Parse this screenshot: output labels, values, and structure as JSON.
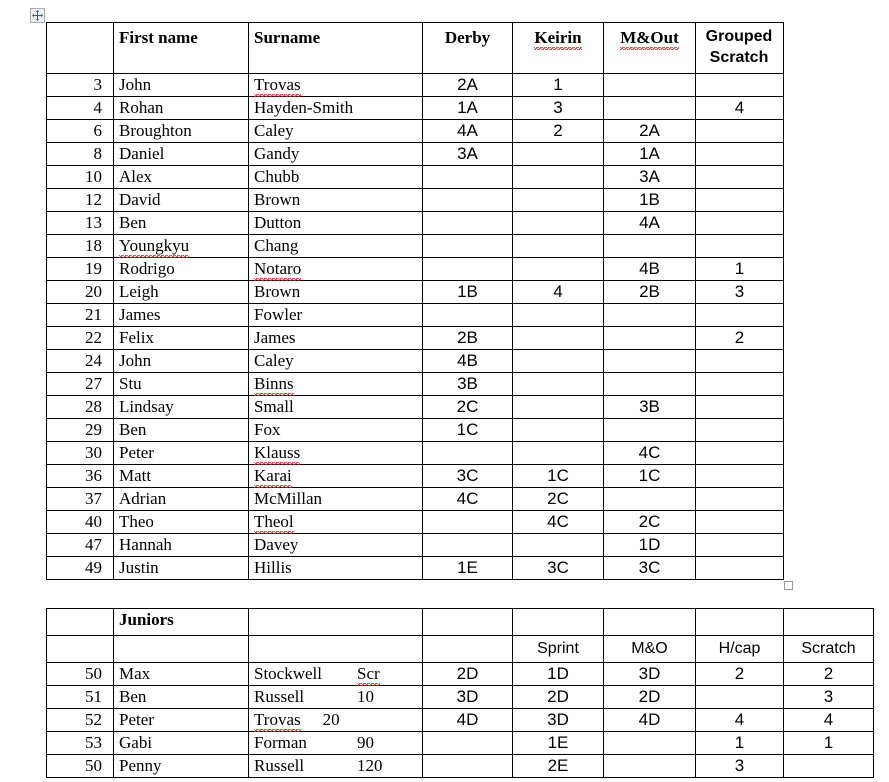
{
  "document": {
    "table_move_handle_icon": "move-cross-icon",
    "resize_handle_icon": "table-resize-handle"
  },
  "main_table": {
    "headers": {
      "number": "",
      "first_name": "First name",
      "surname": "Surname",
      "derby": "Derby",
      "keirin": "Keirin",
      "madison_out": "M&Out",
      "grouped_scratch": "Grouped Scratch"
    },
    "rows": [
      {
        "num": "3",
        "first": "John",
        "last": "Trovas",
        "last_misspelled": true,
        "first_misspelled": false,
        "derby": "2A",
        "keirin": "1",
        "mout": "",
        "gs": ""
      },
      {
        "num": "4",
        "first": "Rohan",
        "last": "Hayden-Smith",
        "last_misspelled": false,
        "first_misspelled": false,
        "derby": "1A",
        "keirin": "3",
        "mout": "",
        "gs": "4"
      },
      {
        "num": "6",
        "first": "Broughton",
        "last": "Caley",
        "last_misspelled": false,
        "first_misspelled": false,
        "derby": "4A",
        "keirin": "2",
        "mout": "2A",
        "gs": ""
      },
      {
        "num": "8",
        "first": "Daniel",
        "last": "Gandy",
        "last_misspelled": false,
        "first_misspelled": false,
        "derby": "3A",
        "keirin": "",
        "mout": "1A",
        "gs": ""
      },
      {
        "num": "10",
        "first": "Alex",
        "last": "Chubb",
        "last_misspelled": false,
        "first_misspelled": false,
        "derby": "",
        "keirin": "",
        "mout": "3A",
        "gs": ""
      },
      {
        "num": "12",
        "first": "David",
        "last": "Brown",
        "last_misspelled": false,
        "first_misspelled": false,
        "derby": "",
        "keirin": "",
        "mout": "1B",
        "gs": ""
      },
      {
        "num": "13",
        "first": "Ben",
        "last": "Dutton",
        "last_misspelled": false,
        "first_misspelled": false,
        "derby": "",
        "keirin": "",
        "mout": "4A",
        "gs": ""
      },
      {
        "num": "18",
        "first": "Youngkyu",
        "last": "Chang",
        "last_misspelled": false,
        "first_misspelled": true,
        "derby": "",
        "keirin": "",
        "mout": "",
        "gs": ""
      },
      {
        "num": "19",
        "first": "Rodrigo",
        "last": "Notaro",
        "last_misspelled": true,
        "first_misspelled": false,
        "derby": "",
        "keirin": "",
        "mout": "4B",
        "gs": "1"
      },
      {
        "num": "20",
        "first": "Leigh",
        "last": "Brown",
        "last_misspelled": false,
        "first_misspelled": false,
        "derby": "1B",
        "keirin": "4",
        "mout": "2B",
        "gs": "3"
      },
      {
        "num": "21",
        "first": "James",
        "last": "Fowler",
        "last_misspelled": false,
        "first_misspelled": false,
        "derby": "",
        "keirin": "",
        "mout": "",
        "gs": ""
      },
      {
        "num": "22",
        "first": "Felix",
        "last": "James",
        "last_misspelled": false,
        "first_misspelled": false,
        "derby": "2B",
        "keirin": "",
        "mout": "",
        "gs": "2"
      },
      {
        "num": "24",
        "first": "John",
        "last": "Caley",
        "last_misspelled": false,
        "first_misspelled": false,
        "derby": "4B",
        "keirin": "",
        "mout": "",
        "gs": ""
      },
      {
        "num": "27",
        "first": "Stu",
        "last": "Binns",
        "last_misspelled": true,
        "first_misspelled": false,
        "derby": "3B",
        "keirin": "",
        "mout": "",
        "gs": ""
      },
      {
        "num": "28",
        "first": "Lindsay",
        "last": "Small",
        "last_misspelled": false,
        "first_misspelled": false,
        "derby": "2C",
        "keirin": "",
        "mout": "3B",
        "gs": ""
      },
      {
        "num": "29",
        "first": "Ben",
        "last": "Fox",
        "last_misspelled": false,
        "first_misspelled": false,
        "derby": "1C",
        "keirin": "",
        "mout": "",
        "gs": ""
      },
      {
        "num": "30",
        "first": "Peter",
        "last": "Klauss",
        "last_misspelled": true,
        "first_misspelled": false,
        "derby": "",
        "keirin": "",
        "mout": "4C",
        "gs": ""
      },
      {
        "num": "36",
        "first": "Matt",
        "last": "Karai",
        "last_misspelled": true,
        "first_misspelled": false,
        "derby": "3C",
        "keirin": "1C",
        "mout": "1C",
        "gs": ""
      },
      {
        "num": "37",
        "first": "Adrian",
        "last": "McMillan",
        "last_misspelled": false,
        "first_misspelled": false,
        "derby": "4C",
        "keirin": "2C",
        "mout": "",
        "gs": ""
      },
      {
        "num": "40",
        "first": "Theo",
        "last": "Theol",
        "last_misspelled": true,
        "first_misspelled": false,
        "derby": "",
        "keirin": "4C",
        "mout": "2C",
        "gs": ""
      },
      {
        "num": "47",
        "first": "Hannah",
        "last": "Davey",
        "last_misspelled": false,
        "first_misspelled": false,
        "derby": "",
        "keirin": "",
        "mout": "1D",
        "gs": ""
      },
      {
        "num": "49",
        "first": "Justin",
        "last": "Hillis",
        "last_misspelled": false,
        "first_misspelled": false,
        "derby": "1E",
        "keirin": "3C",
        "mout": "3C",
        "gs": ""
      }
    ]
  },
  "juniors_table": {
    "title": "Juniors",
    "headers": {
      "number": "",
      "first_name": "",
      "surname": "",
      "derby": "",
      "sprint": "Sprint",
      "madison_out": "M&O",
      "handicap": "H/cap",
      "scratch": "Scratch"
    },
    "rows": [
      {
        "num": "50",
        "first": "Max",
        "last": "Stockwell",
        "hcap_mark": "Scr",
        "last_misspelled": false,
        "hcap_misspelled": true,
        "derby": "2D",
        "sprint": "1D",
        "mo": "3D",
        "hcap": "2",
        "scratch": "2"
      },
      {
        "num": "51",
        "first": "Ben",
        "last": "Russell",
        "hcap_mark": "10",
        "last_misspelled": false,
        "hcap_misspelled": false,
        "derby": "3D",
        "sprint": "2D",
        "mo": "2D",
        "hcap": "",
        "scratch": "3"
      },
      {
        "num": "52",
        "first": "Peter",
        "last": "Trovas",
        "hcap_mark": "20",
        "last_misspelled": true,
        "hcap_misspelled": false,
        "derby": "4D",
        "sprint": "3D",
        "mo": "4D",
        "hcap": "4",
        "scratch": "4"
      },
      {
        "num": "53",
        "first": "Gabi",
        "last": "Forman",
        "hcap_mark": "90",
        "last_misspelled": false,
        "hcap_misspelled": false,
        "derby": "",
        "sprint": "1E",
        "mo": "",
        "hcap": "1",
        "scratch": "1"
      },
      {
        "num": "50",
        "first": "Penny",
        "last": "Russell",
        "hcap_mark": "120",
        "last_misspelled": false,
        "hcap_misspelled": false,
        "derby": "",
        "sprint": "2E",
        "mo": "",
        "hcap": "3",
        "scratch": ""
      }
    ]
  }
}
